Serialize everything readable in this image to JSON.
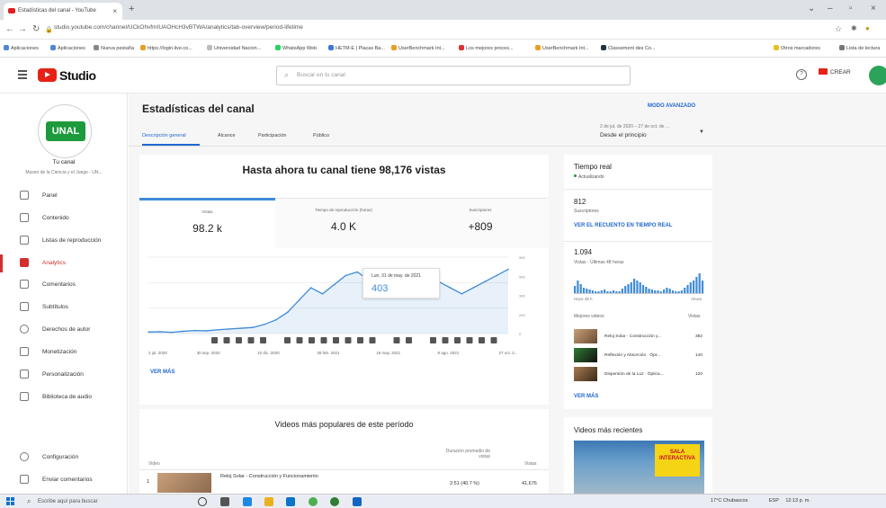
{
  "browser": {
    "tab_title": "Estadísticas del canal - YouTube",
    "url": "studio.youtube.com/channel/UCkOhvfmIUAOHcH3vBTWA/analytics/tab-overview/period-lifetime",
    "bookmarks": [
      "Aplicaciones",
      "Aplicaciones",
      "Nueva pestaña",
      "https://login.live.co...",
      "Universidad Nacion...",
      "WhatsApp Web",
      "HETM-E | Placas Ba...",
      "UserBenchmark Int...",
      "Los mejores proces...",
      "UserBenchmark Int...",
      "Classement des Co...",
      "Otros marcadores",
      "Lista de lectura"
    ]
  },
  "header": {
    "studio_label": "Studio",
    "search_placeholder": "Buscar en tu canal",
    "create_label": "CREAR"
  },
  "channel": {
    "logo_text": "UNAL",
    "name": "Tu canal",
    "subtitle": "Museo de la Ciencia y el Juego - UN..."
  },
  "sidebar": {
    "items": [
      {
        "label": "Panel",
        "icon": "dashboard-icon"
      },
      {
        "label": "Contenido",
        "icon": "content-icon"
      },
      {
        "label": "Listas de reproducción",
        "icon": "playlist-icon"
      },
      {
        "label": "Analytics",
        "icon": "analytics-icon"
      },
      {
        "label": "Comentarios",
        "icon": "comments-icon"
      },
      {
        "label": "Subtítulos",
        "icon": "subtitles-icon"
      },
      {
        "label": "Derechos de autor",
        "icon": "copyright-icon"
      },
      {
        "label": "Monetización",
        "icon": "monetization-icon"
      },
      {
        "label": "Personalización",
        "icon": "customization-icon"
      },
      {
        "label": "Biblioteca de audio",
        "icon": "audio-library-icon"
      }
    ],
    "bottom": [
      {
        "label": "Configuración",
        "icon": "settings-icon"
      },
      {
        "label": "Enviar comentarios",
        "icon": "feedback-icon"
      }
    ]
  },
  "page": {
    "title": "Estadísticas del canal",
    "advanced_mode": "MODO AVANZADO",
    "tabs": [
      "Descripción general",
      "Alcance",
      "Participación",
      "Público"
    ],
    "date_range_small": "2 de jul. de 2020 – 27 de oct. de ...",
    "date_range_label": "Desde el principio"
  },
  "overview": {
    "headline": "Hasta ahora tu canal tiene 98,176 vistas",
    "metrics": [
      {
        "label": "Vistas",
        "value": "98.2 k"
      },
      {
        "label": "Tiempo de reproducción (horas)",
        "value": "4.0 K"
      },
      {
        "label": "Suscriptores",
        "value": "+809"
      }
    ],
    "tooltip_date": "Lun, 31 de may. de 2021",
    "tooltip_value": "403",
    "see_more": "VER MÁS"
  },
  "chart_data": {
    "type": "line",
    "x_ticks": [
      "2 jul. 2020",
      "30 sep. 2020",
      "10 dic. 2020",
      "28 feb. 2021",
      "19 may. 2021",
      "8 ago. 2021",
      "27 oct. 2..."
    ],
    "y_ticks": [
      "0",
      "200",
      "300",
      "500",
      "900"
    ],
    "series": [
      {
        "values": [
          10,
          12,
          8,
          15,
          20,
          18,
          25,
          30,
          35,
          40,
          60,
          90,
          140,
          220,
          300,
          260,
          320,
          380,
          403,
          350,
          330,
          300,
          280,
          320,
          360,
          340,
          300,
          260,
          300,
          340,
          380,
          420
        ]
      }
    ]
  },
  "popular": {
    "title": "Videos más populares de este período",
    "col_video": "Video",
    "col_duration": "Duración promedio de vistas",
    "col_views": "Vistas",
    "rows": [
      {
        "rank": "1",
        "title": "Reloj Solar - Construcción y Funcionamiento",
        "duration": "2:51 (40.7 %)",
        "views": "41,676"
      }
    ]
  },
  "realtime": {
    "title": "Tiempo real",
    "status": "Actualizando",
    "subs_value": "812",
    "subs_label": "Suscriptores",
    "see_realtime": "VER EL RECUENTO EN TIEMPO REAL",
    "views_value": "1.094",
    "views_label": "Vistas · Últimas 48 horas",
    "bar_left": "Hace 48 h",
    "bar_right": "Ahora",
    "top_videos_label": "Mejores videos",
    "views_col": "Vistas",
    "videos": [
      {
        "title": "Reloj Solar - Construcción y...",
        "views": "382"
      },
      {
        "title": "Reflexión y Absorción · Ópt...",
        "views": "140"
      },
      {
        "title": "Dispersión de la Luz · Óptica...",
        "views": "120"
      }
    ],
    "see_more": "VER MÁS"
  },
  "recent": {
    "title": "Videos más recientes",
    "banner_text": "SALA INTERACTIVA"
  },
  "taskbar": {
    "search_placeholder": "Escribe aquí para buscar",
    "weather": "17°C Chubascos",
    "lang": "ESP",
    "time": "12:13 p. m."
  },
  "colors": {
    "accent_blue": "#2167ce",
    "youtube_red": "#e62117",
    "chart_blue": "#3e8bd8",
    "unal_green": "#1d9a3b"
  }
}
